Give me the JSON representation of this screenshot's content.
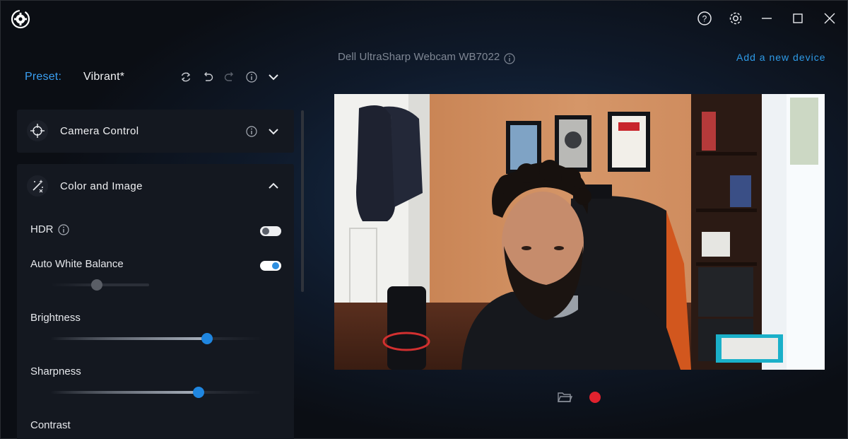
{
  "app": {
    "logo_icon": "dell-peripheral-manager-logo-icon",
    "title_bar": {
      "help_icon": "help-icon",
      "settings_icon": "gear-icon",
      "minimize_icon": "minimize-icon",
      "maximize_icon": "maximize-icon",
      "close_icon": "close-icon"
    }
  },
  "preset": {
    "label": "Preset:",
    "value": "Vibrant*",
    "actions": [
      "sync-icon",
      "undo-icon",
      "redo-icon",
      "info-icon",
      "chevron-down-icon"
    ]
  },
  "sections": {
    "camera_control": {
      "title": "Camera Control",
      "icon": "crosshair-icon",
      "expanded": false
    },
    "color_image": {
      "title": "Color and Image",
      "icon": "magic-wand-icon",
      "expanded": true,
      "hdr": {
        "label": "HDR",
        "on": false
      },
      "awb": {
        "label": "Auto White Balance",
        "on": true,
        "level": 0.47
      },
      "brightness": {
        "label": "Brightness",
        "level": 0.74
      },
      "sharpness": {
        "label": "Sharpness",
        "level": 0.7
      },
      "contrast": {
        "label": "Contrast"
      }
    }
  },
  "device": {
    "name": "Dell UltraSharp Webcam WB7022",
    "add_label": "Add a new device"
  },
  "preview": {
    "controls": [
      "folder-icon",
      "record-icon"
    ]
  },
  "colors": {
    "accent": "#2e9be8",
    "record": "#e0222e",
    "panel": "#141820"
  }
}
